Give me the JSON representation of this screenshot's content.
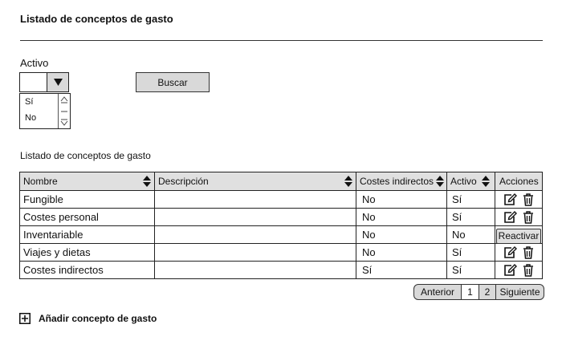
{
  "page": {
    "title": "Listado de conceptos de gasto"
  },
  "filter": {
    "label": "Activo",
    "selected": "",
    "options": [
      "Sí",
      "No"
    ],
    "search_label": "Buscar"
  },
  "table": {
    "caption": "Listado de conceptos de gasto",
    "headers": [
      "Nombre",
      "Descripción",
      "Costes indirectos",
      "Activo",
      "Acciones"
    ],
    "rows": [
      {
        "nombre": "Fungible",
        "descripcion": "",
        "costes": "No",
        "activo": "Sí"
      },
      {
        "nombre": "Costes personal",
        "descripcion": "",
        "costes": "No",
        "activo": "Sí"
      },
      {
        "nombre": "Inventariable",
        "descripcion": "",
        "costes": "No",
        "activo": "No",
        "action": "Reactivar"
      },
      {
        "nombre": "Viajes y dietas",
        "descripcion": "",
        "costes": "No",
        "activo": "Sí"
      },
      {
        "nombre": "Costes indirectos",
        "descripcion": "",
        "costes": "Sí",
        "activo": "Sí"
      }
    ]
  },
  "pagination": {
    "prev": "Anterior",
    "pages": [
      "1",
      "2"
    ],
    "current": "1",
    "next": "Siguiente"
  },
  "add": {
    "label": "Añadir concepto de gasto"
  },
  "icons": {
    "sort": "sort-icon",
    "edit": "edit-icon",
    "delete": "trash-icon",
    "add": "plus-square-icon",
    "dropdown": "caret-down-icon"
  }
}
